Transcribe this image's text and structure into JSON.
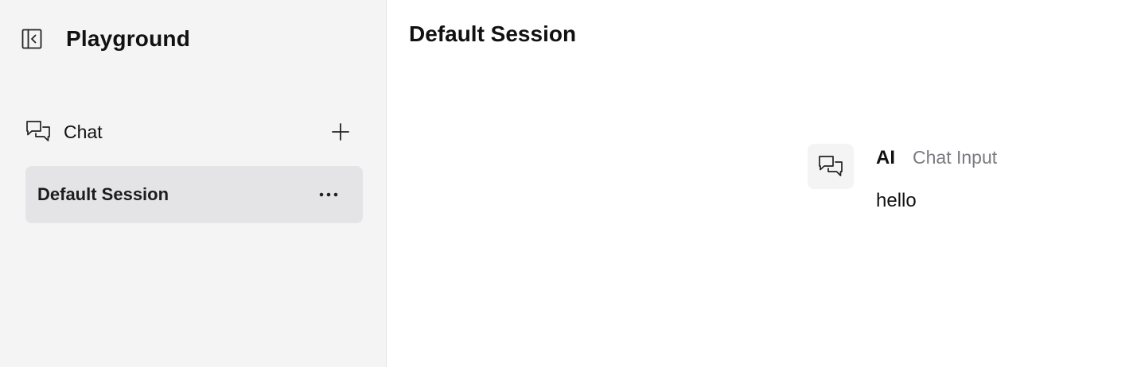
{
  "sidebar": {
    "title": "Playground",
    "section": {
      "label": "Chat"
    },
    "sessions": [
      {
        "label": "Default Session",
        "selected": true
      }
    ]
  },
  "main": {
    "title": "Default Session",
    "messages": [
      {
        "sender": "AI",
        "source": "Chat Input",
        "text": "hello"
      }
    ]
  },
  "icons": {
    "toggle": "sidebar-collapse-icon",
    "chat": "chat-bubbles-icon",
    "add": "plus-icon",
    "more": "more-horizontal-icon",
    "avatar": "chat-bubbles-icon"
  },
  "colors": {
    "sidebar_bg": "#f4f4f4",
    "selected_bg": "#e4e4e7",
    "muted_text": "#7a7a80"
  }
}
